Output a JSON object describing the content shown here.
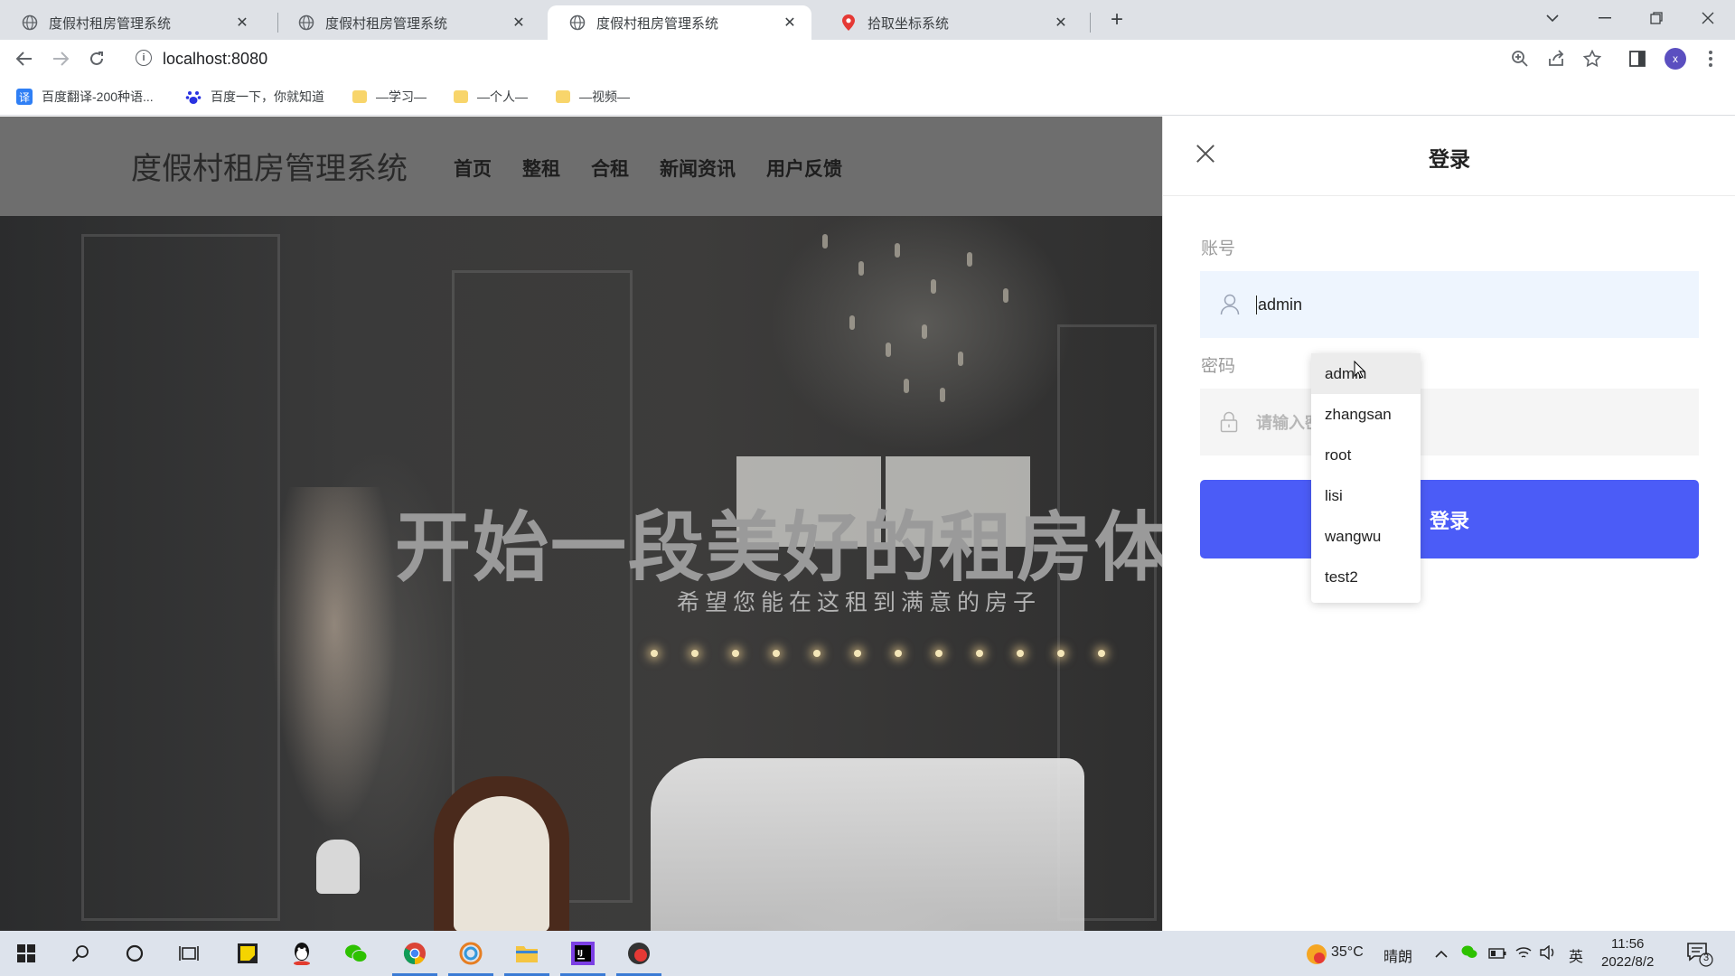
{
  "browser": {
    "tabs": [
      {
        "title": "度假村租房管理系统",
        "active": false
      },
      {
        "title": "度假村租房管理系统",
        "active": false
      },
      {
        "title": "度假村租房管理系统",
        "active": true
      },
      {
        "title": "拾取坐标系统",
        "active": false
      }
    ],
    "url": "localhost:8080",
    "profile_initial": "x",
    "bookmarks": [
      "百度翻译-200种语...",
      "百度一下，你就知道",
      "—学习—",
      "—个人—",
      "—视频—"
    ]
  },
  "site": {
    "logo": "度假村租房管理系统",
    "nav": [
      "首页",
      "整租",
      "合租",
      "新闻资讯",
      "用户反馈"
    ],
    "hero_title": "开始一段美好的租房体",
    "hero_subtitle": "希望您能在这租到满意的房子"
  },
  "login": {
    "title": "登录",
    "account_label": "账号",
    "account_value": "admin",
    "password_label": "密码",
    "password_placeholder": "请输入密",
    "submit_label": "登录",
    "autocomplete": [
      "admin",
      "zhangsan",
      "root",
      "lisi",
      "wangwu",
      "test2"
    ]
  },
  "taskbar": {
    "weather_temp": "35°C",
    "weather_text": "晴朗",
    "ime": "英",
    "time": "11:56",
    "date": "2022/8/2",
    "notification_count": "3"
  },
  "colors": {
    "primary_button": "#4b5cf7",
    "account_field_bg": "#eef5fe"
  }
}
